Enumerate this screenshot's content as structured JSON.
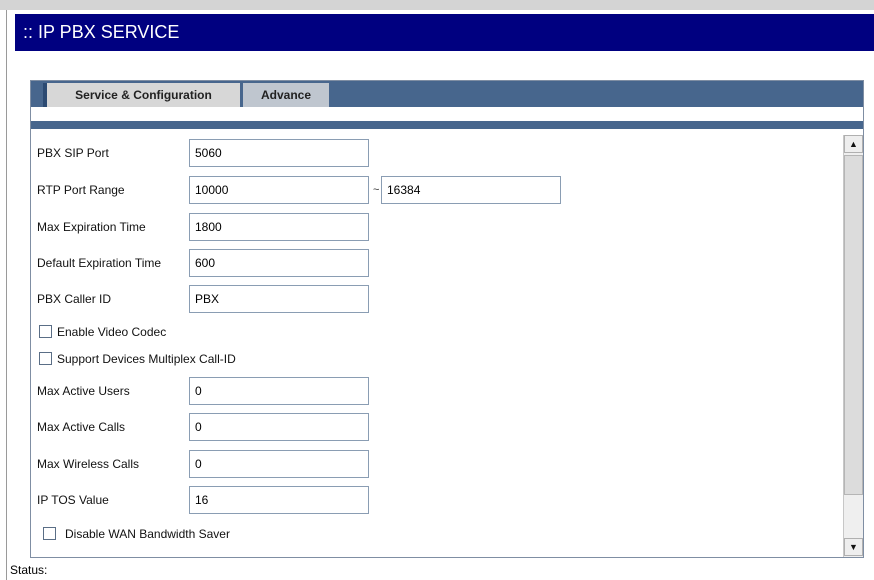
{
  "header": {
    "title": ":: IP PBX SERVICE"
  },
  "tabs": [
    {
      "label": "Service & Configuration",
      "active": true
    },
    {
      "label": "Advance",
      "active": false
    }
  ],
  "form": {
    "pbx_sip_port": {
      "label": "PBX SIP Port",
      "value": "5060"
    },
    "rtp_port_range": {
      "label": "RTP Port Range",
      "from": "10000",
      "separator": "~",
      "to": "16384"
    },
    "max_expiration_time": {
      "label": "Max Expiration Time",
      "value": "1800"
    },
    "default_expiration_time": {
      "label": "Default Expiration Time",
      "value": "600"
    },
    "pbx_caller_id": {
      "label": "PBX Caller ID",
      "value": "PBX"
    },
    "enable_video_codec": {
      "label": "Enable Video Codec",
      "checked": false
    },
    "support_multiplex": {
      "label": "Support Devices Multiplex Call-ID",
      "checked": false
    },
    "max_active_users": {
      "label": "Max Active Users",
      "value": "0"
    },
    "max_active_calls": {
      "label": "Max Active Calls",
      "value": "0"
    },
    "max_wireless_calls": {
      "label": "Max Wireless Calls",
      "value": "0"
    },
    "ip_tos_value": {
      "label": "IP TOS Value",
      "value": "16"
    },
    "disable_wan_saver": {
      "label": "Disable WAN Bandwidth Saver",
      "checked": false
    }
  },
  "scrollbar": {
    "up_glyph": "▲",
    "down_glyph": "▼"
  },
  "status": {
    "label": "Status:"
  },
  "colors": {
    "title_bar": "#000080",
    "tab_strip": "#47668d",
    "field_border": "#8a9db3"
  }
}
